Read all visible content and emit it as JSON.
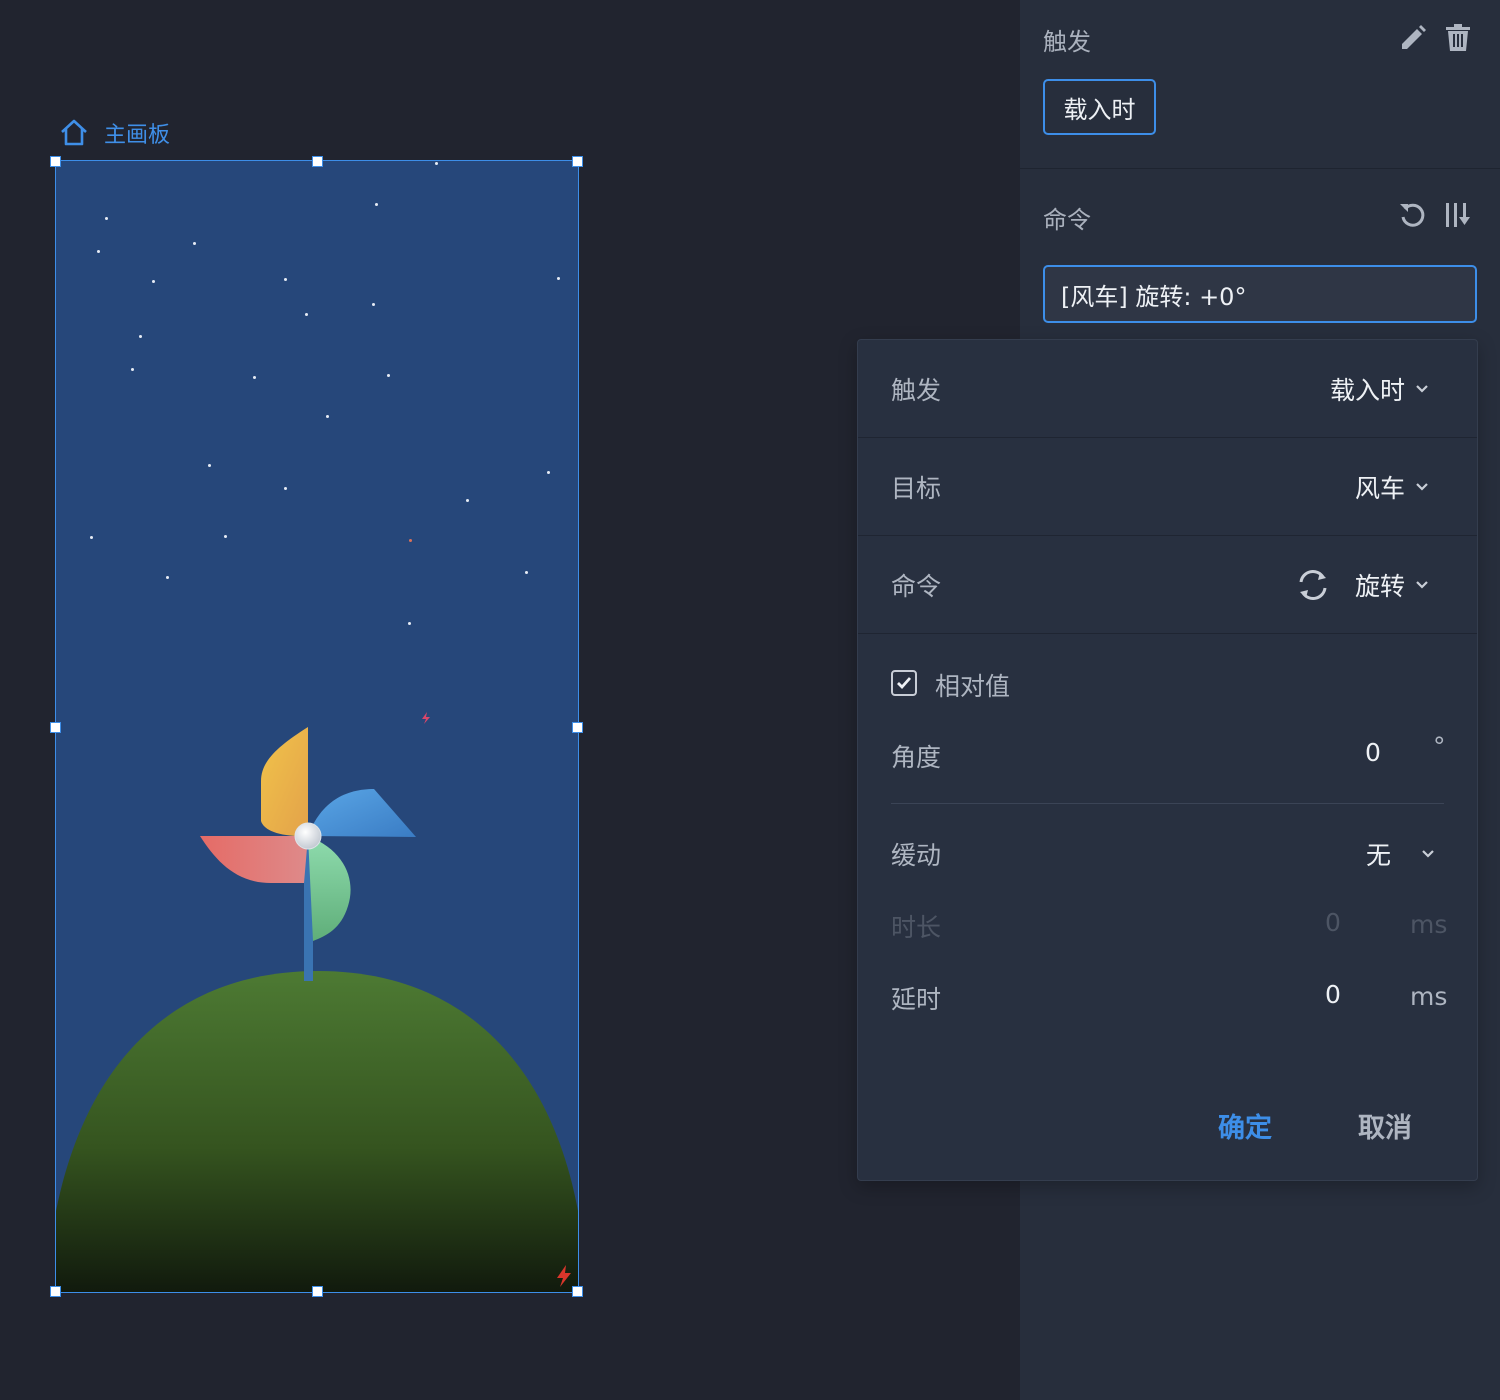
{
  "canvas": {
    "breadcrumb_label": "主画板",
    "artboard": {
      "background": "#26477a",
      "hill_color": "#4d7a33"
    }
  },
  "sidebar": {
    "trigger_title": "触发",
    "trigger_chip": "载入时",
    "command_title": "命令",
    "command_value": "[风车] 旋转: +0°",
    "accent": "#3d8ee8"
  },
  "popover": {
    "trigger": {
      "label": "触发",
      "value": "载入时"
    },
    "target": {
      "label": "目标",
      "value": "风车"
    },
    "command": {
      "label": "命令",
      "value": "旋转"
    },
    "relative": {
      "label": "相对值",
      "checked": true
    },
    "angle": {
      "label": "角度",
      "value": "0",
      "unit": "°"
    },
    "easing": {
      "label": "缓动",
      "value": "无"
    },
    "duration": {
      "label": "时长",
      "value": "0",
      "unit": "ms",
      "disabled": true
    },
    "delay": {
      "label": "延时",
      "value": "0",
      "unit": "ms"
    },
    "confirm_label": "确定",
    "cancel_label": "取消"
  }
}
